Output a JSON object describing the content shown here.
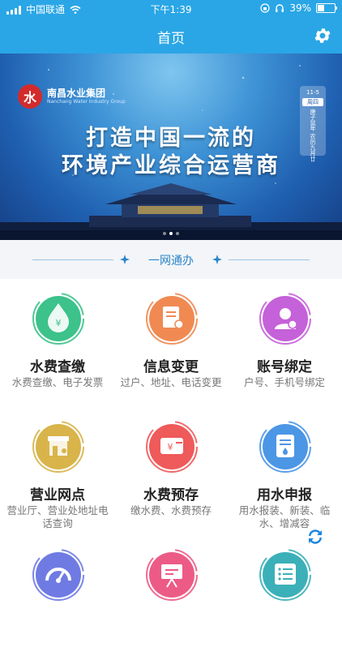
{
  "status_bar": {
    "carrier": "中国联通",
    "time": "下午1:39",
    "battery": "39%",
    "battery_level": 0.39
  },
  "nav": {
    "title": "首页",
    "settings_icon": "gear-icon"
  },
  "banner": {
    "logo_mark": "水",
    "company_name": "南昌水业集团",
    "company_name_en": "Nanchang Water Industry Group",
    "date_top": "11-5",
    "date_weekday": "周四",
    "date_lunar": "庚子鼠年 农历九月廿",
    "slogan_line1": "打造中国一流的",
    "slogan_line2": "环境产业综合运营商",
    "page_count": 3,
    "active_page": 1
  },
  "section": {
    "title": "一网通办"
  },
  "services": [
    {
      "title": "水费查缴",
      "desc": "水费查缴、电子发票",
      "icon": "water-drop-yen-icon",
      "color": "#3cc28a",
      "ring": "#3cc28a"
    },
    {
      "title": "信息变更",
      "desc": "过户、地址、电话变更",
      "icon": "document-edit-icon",
      "color": "#f08a52",
      "ring": "#f08a52"
    },
    {
      "title": "账号绑定",
      "desc": "户号、手机号绑定",
      "icon": "user-link-icon",
      "color": "#c561d9",
      "ring": "#c561d9"
    },
    {
      "title": "营业网点",
      "desc": "营业厅、营业处地址电话查询",
      "icon": "storefront-icon",
      "color": "#d8b44a",
      "ring": "#d8b44a"
    },
    {
      "title": "水费预存",
      "desc": "缴水费、水费预存",
      "icon": "wallet-pay-icon",
      "color": "#ef5a5a",
      "ring": "#ef5a5a"
    },
    {
      "title": "用水申报",
      "desc": "用水报装、新装、临水、增减容",
      "icon": "water-form-icon",
      "color": "#4c96e6",
      "ring": "#4c96e6"
    },
    {
      "title": "",
      "desc": "",
      "icon": "speedometer-icon",
      "color": "#6f7be3",
      "ring": "#6f7be3"
    },
    {
      "title": "",
      "desc": "",
      "icon": "presentation-icon",
      "color": "#ec5b86",
      "ring": "#ec5b86"
    },
    {
      "title": "",
      "desc": "",
      "icon": "list-icon",
      "color": "#3bb0b8",
      "ring": "#3bb0b8"
    }
  ],
  "refresh_icon": "refresh-icon"
}
